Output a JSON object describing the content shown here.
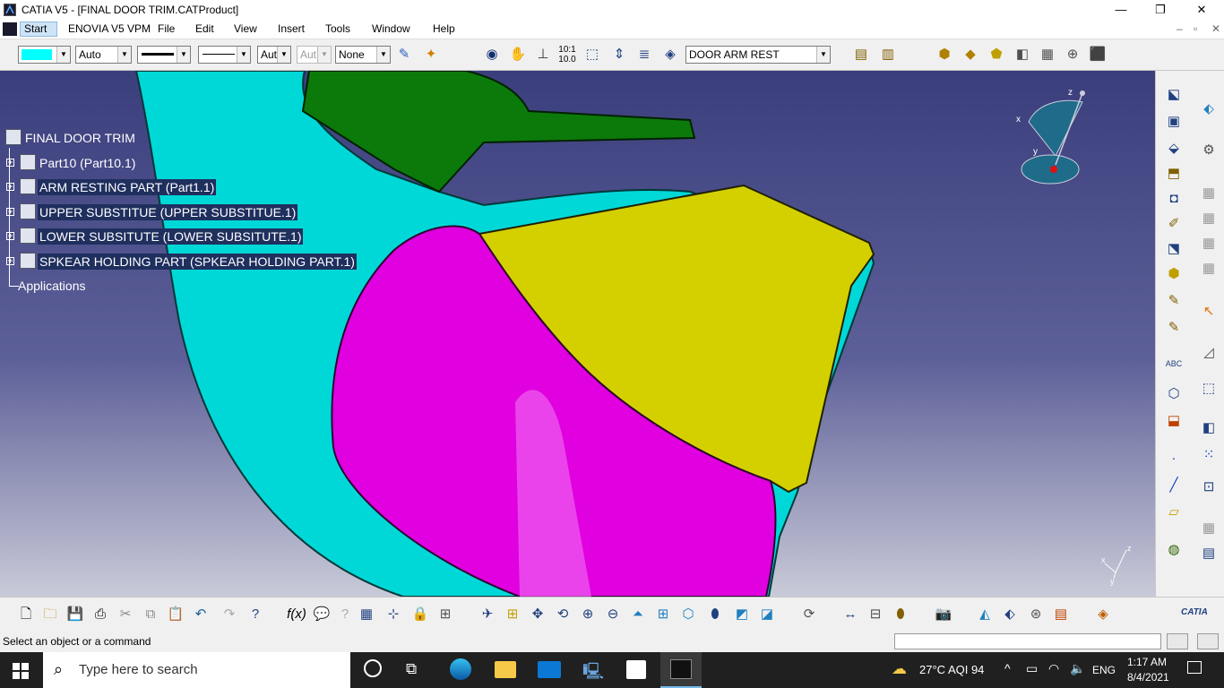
{
  "window": {
    "title": "CATIA V5 - [FINAL DOOR TRIM.CATProduct]",
    "minimize": "—",
    "restore": "❐",
    "close": "✕"
  },
  "menu": {
    "items": [
      "Start",
      "ENOVIA V5 VPM",
      "File",
      "Edit",
      "View",
      "Insert",
      "Tools",
      "Window",
      "Help"
    ],
    "doc_controls": [
      "–",
      "▫",
      "✕"
    ]
  },
  "toolbar": {
    "color_swatch": "#00ffff",
    "layer_value": "Auto",
    "lineweight_value": "Aut",
    "linetype_value": "Aut",
    "pattern_value": "None",
    "product_selector": "DOOR ARM REST"
  },
  "tree": {
    "root": "FINAL DOOR TRIM",
    "items": [
      {
        "label": "Part10 (Part10.1)",
        "selected": false
      },
      {
        "label": "ARM RESTING PART (Part1.1)",
        "selected": true
      },
      {
        "label": "UPPER SUBSTITUE (UPPER SUBSTITUE.1)",
        "selected": true
      },
      {
        "label": "LOWER SUBSITUTE (LOWER SUBSITUTE.1)",
        "selected": true
      },
      {
        "label": "SPKEAR HOLDING PART (SPKEAR HOLDING PART.1)",
        "selected": true
      }
    ],
    "applications": "Applications"
  },
  "compass": {
    "x": "x",
    "y": "y",
    "z": "z"
  },
  "axis_triad": {
    "x": "x",
    "y": "y",
    "z": "z"
  },
  "colors": {
    "cyan_part": "#00d8d8",
    "green_part": "#0b7a0b",
    "yellow_part": "#d4d000",
    "magenta_part": "#e000e0",
    "viewport_top": "#3a3e7c",
    "viewport_bottom": "#c9cad8"
  },
  "status": {
    "message": "Select an object or a command"
  },
  "brand": {
    "logo_text": "CATIA"
  },
  "taskbar": {
    "search_placeholder": "Type here to search",
    "weather": "27°C  AQI 94",
    "language": "ENG",
    "time": "1:17 AM",
    "date": "8/4/2021"
  }
}
